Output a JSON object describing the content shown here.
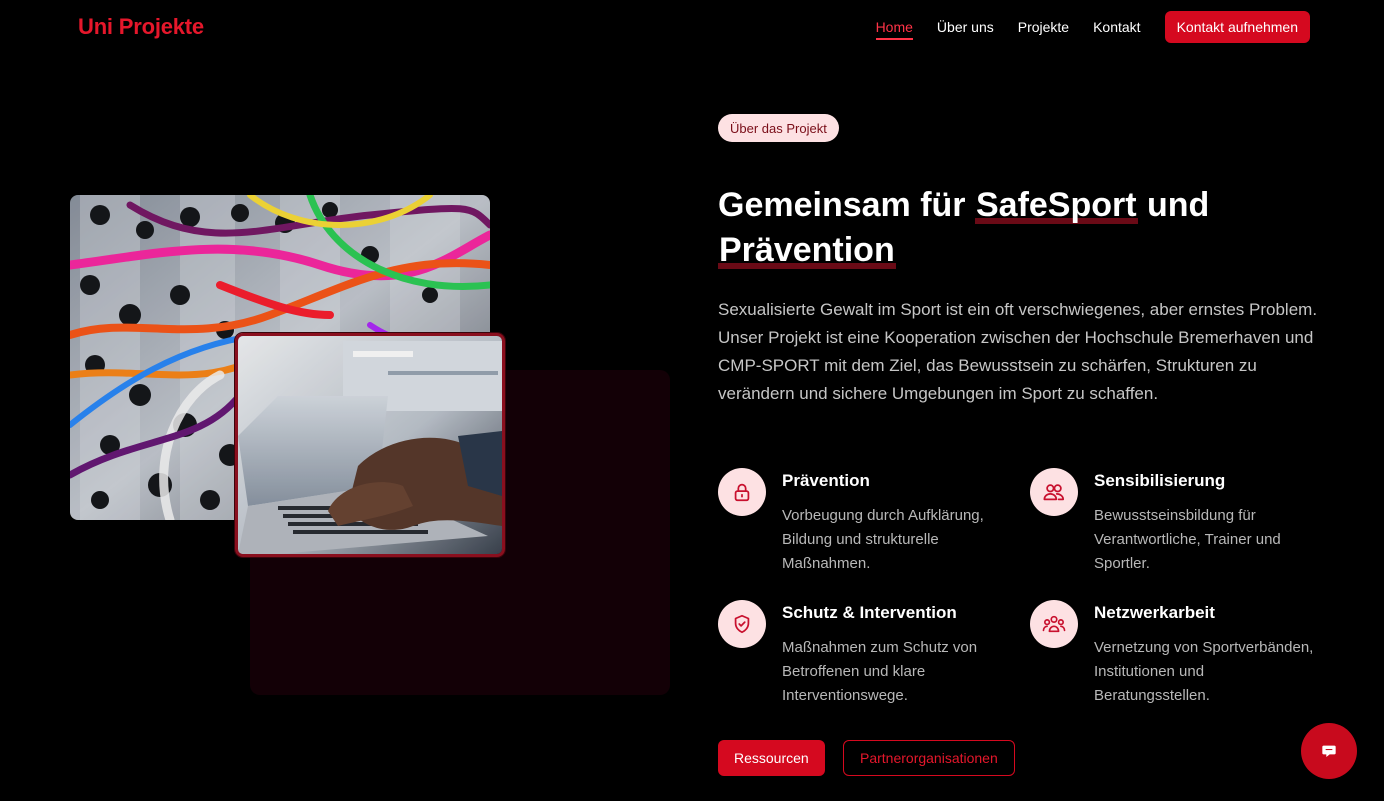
{
  "header": {
    "brand": "Uni Projekte",
    "nav": [
      {
        "label": "Home",
        "active": true
      },
      {
        "label": "Über uns",
        "active": false
      },
      {
        "label": "Projekte",
        "active": false
      },
      {
        "label": "Kontakt",
        "active": false
      }
    ],
    "cta": "Kontakt aufnehmen"
  },
  "hero": {
    "badge": "Über das Projekt",
    "headline": {
      "part1": "Gemeinsam für ",
      "highlight1": "SafeSport",
      "part2": " und ",
      "highlight2": "Prävention"
    },
    "intro": "Sexualisierte Gewalt im Sport ist ein oft verschwiegenes, aber ernstes Problem. Unser Projekt ist eine Kooperation zwischen der Hochschule Bremerhaven und CMP-SPORT mit dem Ziel, das Bewusstsein zu schärfen, Strukturen zu verändern und sichere Umgebungen im Sport zu schaffen.",
    "features": [
      {
        "icon": "lock-icon",
        "title": "Prävention",
        "desc": "Vorbeugung durch Aufklärung, Bildung und strukturelle Maßnahmen."
      },
      {
        "icon": "users-icon",
        "title": "Sensibilisierung",
        "desc": "Bewusstseinsbildung für Verantwortliche, Trainer und Sportler."
      },
      {
        "icon": "shield-check-icon",
        "title": "Schutz & Intervention",
        "desc": "Maßnahmen zum Schutz von Betroffenen und klare Interventionswege."
      },
      {
        "icon": "network-icon",
        "title": "Netzwerkarbeit",
        "desc": "Vernetzung von Sportverbänden, Institutionen und Beratungsstellen."
      }
    ],
    "buttons": {
      "primary": "Ressourcen",
      "secondary": "Partnerorganisationen"
    }
  },
  "images": {
    "main": "patch-cables-photo",
    "overlay": "laptop-typing-photo"
  },
  "chat": {
    "icon": "chat-icon"
  },
  "colors": {
    "accent": "#d5091f",
    "brand": "#e5172b",
    "badge_bg": "#fde1e3",
    "background": "#000000"
  }
}
